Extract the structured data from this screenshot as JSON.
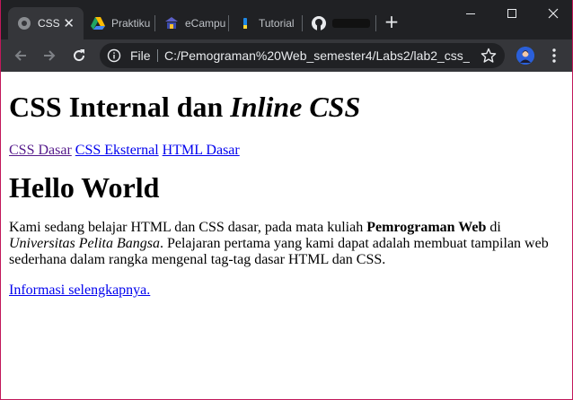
{
  "browser": {
    "tabs": [
      {
        "title": "CSS",
        "active": true,
        "favicon": "globe-icon"
      },
      {
        "title": "Praktiku",
        "active": false,
        "favicon": "google-drive-icon"
      },
      {
        "title": "eCampu",
        "active": false,
        "favicon": "campus-icon"
      },
      {
        "title": "Tutorial",
        "active": false,
        "favicon": "tutorial-icon"
      },
      {
        "title": "",
        "active": false,
        "favicon": "github-icon"
      }
    ],
    "tab_close": "✕",
    "new_tab": "+",
    "omnibox": {
      "scheme_label": "File",
      "url": "C:/Pemograman%20Web_semester4/Labs2/lab2_css_..."
    }
  },
  "page": {
    "title_prefix": "CSS Internal dan ",
    "title_italic": "Inline CSS",
    "nav_links": [
      "CSS Dasar",
      "CSS Eksternal",
      "HTML Dasar"
    ],
    "heading": "Hello World",
    "paragraph": {
      "part1": "Kami sedang belajar HTML dan CSS dasar, pada mata kuliah ",
      "bold": "Pemrograman Web",
      "part2": " di ",
      "italic": "Universitas Pelita Bangsa",
      "part3": ". Pelajaran pertama yang kami dapat adalah membuat tampilan web sederhana dalam rangka mengenal tag-tag dasar HTML dan CSS."
    },
    "more_link": "Informasi selengkapnya."
  },
  "colors": {
    "tabstrip": "#202124",
    "toolbar": "#35363a",
    "link": "#0000ee",
    "link_visited": "#551a8b",
    "frame_accent": "#c2185b"
  }
}
